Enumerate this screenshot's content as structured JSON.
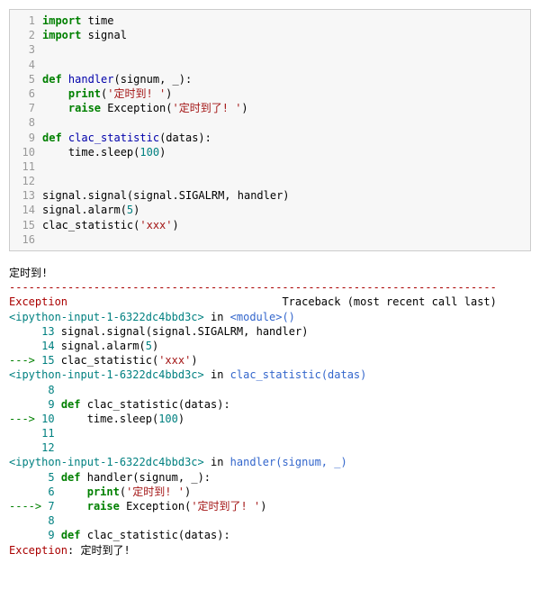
{
  "code": {
    "lines": [
      {
        "n": "1",
        "tokens": [
          {
            "c": "kw",
            "t": "import"
          },
          {
            "c": "",
            "t": " time"
          }
        ]
      },
      {
        "n": "2",
        "tokens": [
          {
            "c": "kw",
            "t": "import"
          },
          {
            "c": "",
            "t": " signal"
          }
        ]
      },
      {
        "n": "3",
        "tokens": []
      },
      {
        "n": "4",
        "tokens": []
      },
      {
        "n": "5",
        "tokens": [
          {
            "c": "kw",
            "t": "def"
          },
          {
            "c": "",
            "t": " "
          },
          {
            "c": "fn",
            "t": "handler"
          },
          {
            "c": "",
            "t": "(signum, _):"
          }
        ]
      },
      {
        "n": "6",
        "tokens": [
          {
            "c": "",
            "t": "    "
          },
          {
            "c": "kw",
            "t": "print"
          },
          {
            "c": "",
            "t": "("
          },
          {
            "c": "str",
            "t": "'定时到! '"
          },
          {
            "c": "",
            "t": ")"
          }
        ]
      },
      {
        "n": "7",
        "tokens": [
          {
            "c": "",
            "t": "    "
          },
          {
            "c": "kw",
            "t": "raise"
          },
          {
            "c": "",
            "t": " Exception("
          },
          {
            "c": "str",
            "t": "'定时到了! '"
          },
          {
            "c": "",
            "t": ")"
          }
        ]
      },
      {
        "n": "8",
        "tokens": []
      },
      {
        "n": "9",
        "tokens": [
          {
            "c": "kw",
            "t": "def"
          },
          {
            "c": "",
            "t": " "
          },
          {
            "c": "fn",
            "t": "clac_statistic"
          },
          {
            "c": "",
            "t": "(datas):"
          }
        ]
      },
      {
        "n": "10",
        "tokens": [
          {
            "c": "",
            "t": "    time.sleep("
          },
          {
            "c": "num",
            "t": "100"
          },
          {
            "c": "",
            "t": ")"
          }
        ]
      },
      {
        "n": "11",
        "tokens": []
      },
      {
        "n": "12",
        "tokens": []
      },
      {
        "n": "13",
        "tokens": [
          {
            "c": "",
            "t": "signal.signal(signal.SIGALRM, handler)"
          }
        ]
      },
      {
        "n": "14",
        "tokens": [
          {
            "c": "",
            "t": "signal.alarm("
          },
          {
            "c": "num",
            "t": "5"
          },
          {
            "c": "",
            "t": ")"
          }
        ]
      },
      {
        "n": "15",
        "tokens": [
          {
            "c": "",
            "t": "clac_statistic("
          },
          {
            "c": "str",
            "t": "'xxx'"
          },
          {
            "c": "",
            "t": ")"
          }
        ]
      },
      {
        "n": "16",
        "tokens": []
      }
    ]
  },
  "output": {
    "timer_msg": "定时到!",
    "dash_row": "---------------------------------------------------------------------------",
    "exception_header_left": "Exception",
    "exception_header_right": "Traceback (most recent call last)",
    "frames": [
      {
        "file": "<ipython-input-1-6322dc4bbd3c>",
        "in": " in ",
        "func": "<module>",
        "args": "()",
        "lines": [
          {
            "arrow": "     ",
            "no": "13",
            "tokens": [
              {
                "c": "tb-fn",
                "t": " signal"
              },
              {
                "c": "",
                "t": "."
              },
              {
                "c": "tb-fn",
                "t": "signal"
              },
              {
                "c": "",
                "t": "("
              },
              {
                "c": "tb-fn",
                "t": "signal"
              },
              {
                "c": "",
                "t": "."
              },
              {
                "c": "tb-fn",
                "t": "SIGALRM"
              },
              {
                "c": "",
                "t": ", "
              },
              {
                "c": "tb-fn",
                "t": "handler"
              },
              {
                "c": "",
                "t": ")"
              }
            ]
          },
          {
            "arrow": "     ",
            "no": "14",
            "tokens": [
              {
                "c": "tb-fn",
                "t": " signal"
              },
              {
                "c": "",
                "t": "."
              },
              {
                "c": "tb-fn",
                "t": "alarm"
              },
              {
                "c": "",
                "t": "("
              },
              {
                "c": "tb-num",
                "t": "5"
              },
              {
                "c": "",
                "t": ")"
              }
            ]
          },
          {
            "arrow": "---> ",
            "no": "15",
            "tokens": [
              {
                "c": "tb-fn",
                "t": " clac_statistic"
              },
              {
                "c": "",
                "t": "("
              },
              {
                "c": "tb-str",
                "t": "'xxx'"
              },
              {
                "c": "",
                "t": ")"
              }
            ]
          }
        ]
      },
      {
        "file": "<ipython-input-1-6322dc4bbd3c>",
        "in": " in ",
        "func": "clac_statistic",
        "args": "(datas)",
        "lines": [
          {
            "arrow": "      ",
            "no": "8",
            "tokens": [
              {
                "c": "",
                "t": ""
              }
            ]
          },
          {
            "arrow": "      ",
            "no": "9",
            "tokens": [
              {
                "c": "tb-kw",
                "t": " def"
              },
              {
                "c": "tb-fn",
                "t": " clac_statistic"
              },
              {
                "c": "",
                "t": "("
              },
              {
                "c": "tb-fn",
                "t": "datas"
              },
              {
                "c": "",
                "t": "):"
              }
            ]
          },
          {
            "arrow": "---> ",
            "no": "10",
            "tokens": [
              {
                "c": "",
                "t": "     "
              },
              {
                "c": "tb-fn",
                "t": "time"
              },
              {
                "c": "",
                "t": "."
              },
              {
                "c": "tb-fn",
                "t": "sleep"
              },
              {
                "c": "",
                "t": "("
              },
              {
                "c": "tb-num",
                "t": "100"
              },
              {
                "c": "",
                "t": ")"
              }
            ]
          },
          {
            "arrow": "     ",
            "no": "11",
            "tokens": [
              {
                "c": "",
                "t": ""
              }
            ]
          },
          {
            "arrow": "     ",
            "no": "12",
            "tokens": [
              {
                "c": "",
                "t": ""
              }
            ]
          }
        ]
      },
      {
        "file": "<ipython-input-1-6322dc4bbd3c>",
        "in": " in ",
        "func": "handler",
        "args": "(signum, _)",
        "lines": [
          {
            "arrow": "      ",
            "no": "5",
            "tokens": [
              {
                "c": "tb-kw",
                "t": " def"
              },
              {
                "c": "tb-fn",
                "t": " handler"
              },
              {
                "c": "",
                "t": "("
              },
              {
                "c": "tb-fn",
                "t": "signum"
              },
              {
                "c": "",
                "t": ", "
              },
              {
                "c": "tb-fn",
                "t": "_"
              },
              {
                "c": "",
                "t": "):"
              }
            ]
          },
          {
            "arrow": "      ",
            "no": "6",
            "tokens": [
              {
                "c": "",
                "t": "     "
              },
              {
                "c": "tb-kw",
                "t": "print"
              },
              {
                "c": "",
                "t": "("
              },
              {
                "c": "tb-str",
                "t": "'定时到! '"
              },
              {
                "c": "",
                "t": ")"
              }
            ]
          },
          {
            "arrow": "----> ",
            "no": "7",
            "tokens": [
              {
                "c": "",
                "t": "     "
              },
              {
                "c": "tb-kw",
                "t": "raise"
              },
              {
                "c": "",
                "t": " Exception("
              },
              {
                "c": "tb-str",
                "t": "'定时到了! '"
              },
              {
                "c": "",
                "t": ")"
              }
            ]
          },
          {
            "arrow": "      ",
            "no": "8",
            "tokens": [
              {
                "c": "",
                "t": ""
              }
            ]
          },
          {
            "arrow": "      ",
            "no": "9",
            "tokens": [
              {
                "c": "tb-kw",
                "t": " def"
              },
              {
                "c": "tb-fn",
                "t": " clac_statistic"
              },
              {
                "c": "",
                "t": "("
              },
              {
                "c": "tb-fn",
                "t": "datas"
              },
              {
                "c": "",
                "t": "):"
              }
            ]
          }
        ]
      }
    ],
    "final": {
      "name": "Exception",
      "sep": ": ",
      "msg": "定时到了!"
    }
  }
}
